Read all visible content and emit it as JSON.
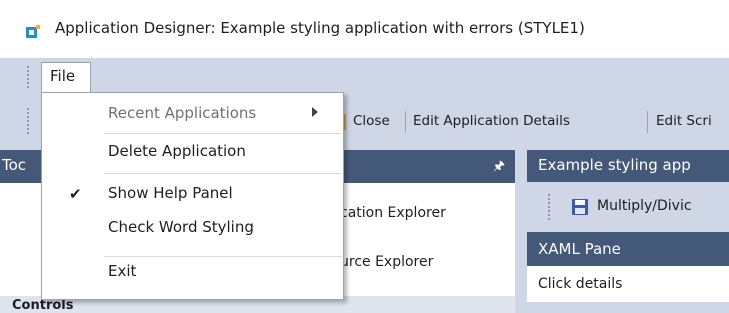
{
  "window": {
    "title": "Application Designer: Example styling application with errors  (STYLE1)"
  },
  "menubar": {
    "file_label": "File"
  },
  "toolbar": {
    "close_label": "Close",
    "edit_details_label": "Edit Application Details",
    "edit_script_label": "Edit Scri"
  },
  "left_panel": {
    "header_label": "Toc",
    "application_explorer_label": "cation Explorer",
    "resource_explorer_label": "urce Explorer",
    "controls_label": "Controls"
  },
  "right_panel": {
    "title": "Example styling app",
    "toolbar_button_label": "Multiply/Divic",
    "xaml_pane_label": "XAML Pane",
    "click_details_label": "Click details"
  },
  "file_dropdown": {
    "items": [
      {
        "label": "Recent Applications",
        "disabled": true,
        "submenu": true,
        "checked": false
      },
      {
        "label": "Delete Application",
        "disabled": false,
        "submenu": false,
        "checked": false
      },
      {
        "label": "Show Help Panel",
        "disabled": false,
        "submenu": false,
        "checked": true
      },
      {
        "label": "Check Word Styling",
        "disabled": false,
        "submenu": false,
        "checked": false
      },
      {
        "label": "Exit",
        "disabled": false,
        "submenu": false,
        "checked": false
      }
    ],
    "check_glyph": "✔"
  },
  "icons": {
    "app": "app-designer-icon",
    "save": "save-icon",
    "pin": "pin-icon",
    "submenu": "chevron-right-icon"
  },
  "colors": {
    "chrome": "#cfd6e5",
    "panel_header": "#44587a",
    "accent_icon": "#1e8fc7"
  }
}
